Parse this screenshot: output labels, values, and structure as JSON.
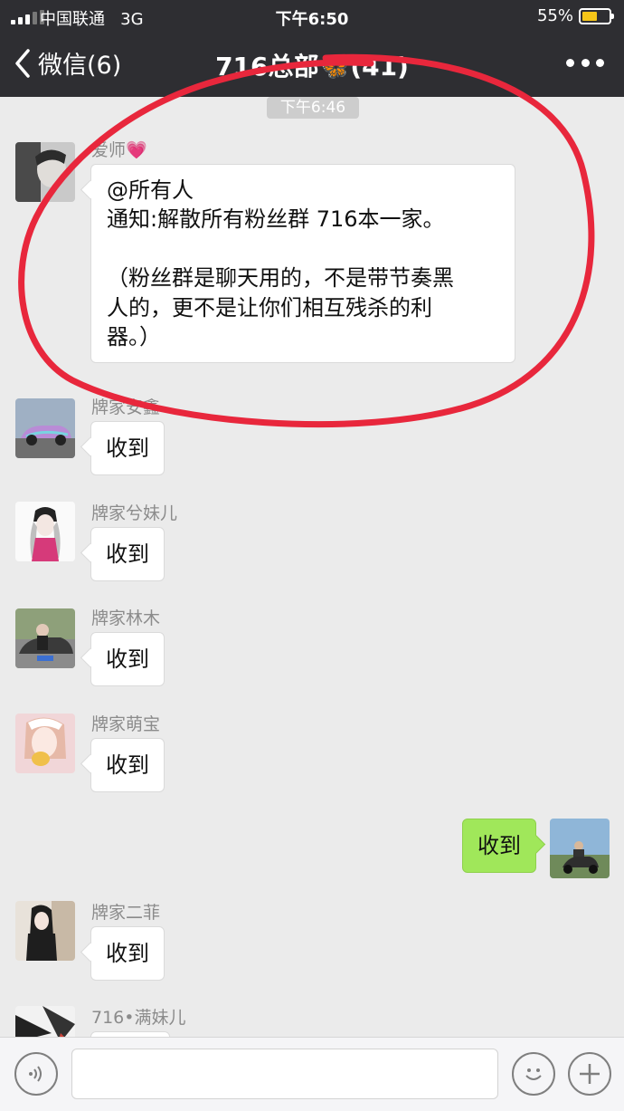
{
  "status_bar": {
    "carrier": "中国联通",
    "network": "3G",
    "time": "下午6:50",
    "battery": "55%",
    "battery_level": 0.55
  },
  "nav": {
    "back_label": "微信(6)",
    "title": "716总部🦋(41)"
  },
  "chat": {
    "timestamp": "下午6:46",
    "messages": [
      {
        "sender": "爱师💗",
        "text_lines": [
          "@所有人",
          "通知:解散所有粉丝群 716本一家。",
          "",
          "（粉丝群是聊天用的，不是带节奏黑",
          "人的，更不是让你们相互残杀的利",
          "器。）"
        ]
      },
      {
        "sender": "牌家安鑫",
        "text": "收到"
      },
      {
        "sender": "牌家兮妹儿",
        "text": "收到"
      },
      {
        "sender": "牌家林木",
        "text": "收到"
      },
      {
        "sender": "牌家萌宝",
        "text": "收到"
      },
      {
        "sender": "me",
        "text": "收到"
      },
      {
        "sender": "牌家二菲",
        "text": "收到"
      },
      {
        "sender": "716•满妹儿",
        "text": ""
      }
    ]
  },
  "icons": {
    "back": "chevron-left-icon",
    "more": "more-dots-icon",
    "voice": "voice-icon",
    "emoji": "emoji-icon",
    "add": "plus-icon"
  },
  "colors": {
    "topbar": "#2e2e32",
    "chat_bg": "#ebebeb",
    "my_bubble": "#a0e75a",
    "annotation": "#e8273c"
  }
}
